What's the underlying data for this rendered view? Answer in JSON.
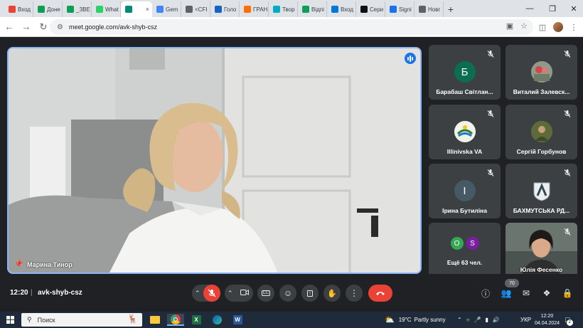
{
  "browser": {
    "tabs": [
      {
        "label": "Вход",
        "icon": "gmail-icon",
        "color": "#ea4335"
      },
      {
        "label": "Доне",
        "icon": "sheets-icon",
        "color": "#0f9d58"
      },
      {
        "label": "_ЗВЕ",
        "icon": "sheets-icon",
        "color": "#0f9d58"
      },
      {
        "label": "What",
        "icon": "whatsapp-icon",
        "color": "#25d366"
      },
      {
        "label": "",
        "icon": "meet-icon",
        "color": "#00897b",
        "active": true
      },
      {
        "label": "Gem",
        "icon": "gemini-icon",
        "color": "#4285f4"
      },
      {
        "label": "<CFI",
        "icon": "globe-icon",
        "color": "#5f6368"
      },
      {
        "label": "Голо",
        "icon": "bird-icon",
        "color": "#1565c0"
      },
      {
        "label": "ГРАН",
        "icon": "c-icon",
        "color": "#ff6f00"
      },
      {
        "label": "Твор",
        "icon": "tvor-icon",
        "color": "#00acc1"
      },
      {
        "label": "Відпі",
        "icon": "sheets-icon",
        "color": "#0f9d58"
      },
      {
        "label": "Вход",
        "icon": "windows-icon",
        "color": "#0078d4"
      },
      {
        "label": "Сери",
        "icon": "hd-icon",
        "color": "#111111"
      },
      {
        "label": "Signi",
        "icon": "signin-icon",
        "color": "#1a73e8"
      },
      {
        "label": "Новг",
        "icon": "globe-icon",
        "color": "#5f6368"
      }
    ],
    "tab_close": "×",
    "new_tab": "+",
    "url": "meet.google.com/avk-shyb-csz"
  },
  "meeting": {
    "time": "12:20",
    "separator": "|",
    "code": "avk-shyb-csz",
    "participants_count": "70",
    "main_speaker": {
      "name": "Марина Тинор"
    },
    "tiles": [
      {
        "name": "Барабаш Світлан...",
        "avatar_letter": "Б",
        "avatar_color": "#0b6e4f",
        "type": "letter"
      },
      {
        "name": "Виталий Залевск...",
        "avatar_letter": "",
        "avatar_color": "#c0392b",
        "type": "photo-flowers"
      },
      {
        "name": "Illinivska VA",
        "avatar_letter": "",
        "avatar_color": "#4caf50",
        "type": "photo-logo"
      },
      {
        "name": "Сергій Горбунов",
        "avatar_letter": "",
        "avatar_color": "#556b2f",
        "type": "photo-person"
      },
      {
        "name": "Ірина Бутиліна",
        "avatar_letter": "I",
        "avatar_color": "#455a64",
        "type": "letter"
      },
      {
        "name": "БАХМУТСЬКА РД...",
        "avatar_letter": "",
        "avatar_color": "#cfd8dc",
        "type": "photo-emblem"
      },
      {
        "name": "Ещё 63 чел.",
        "more_letters": [
          "O",
          "S"
        ],
        "more_colors": [
          "#34a853",
          "#7b1fa2"
        ],
        "type": "more"
      },
      {
        "name": "Юлія Фесенко",
        "type": "video"
      }
    ]
  },
  "taskbar": {
    "search_placeholder": "Поиск",
    "weather_temp": "19°C",
    "weather_text": "Partly sunny",
    "language": "УКР",
    "clock_time": "12:20",
    "clock_date": "04.04.2024",
    "notification_count": "2"
  }
}
